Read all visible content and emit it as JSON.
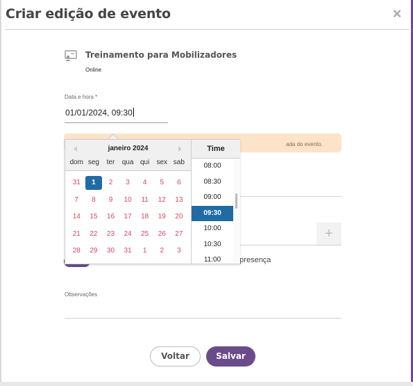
{
  "modal": {
    "title": "Criar edição de evento",
    "close": "×"
  },
  "event": {
    "name": "Treinamento para Mobilizadores",
    "type": "Online",
    "icon": "presentation-icon"
  },
  "datetime": {
    "label": "Data e hora *",
    "value": "01/01/2024, 09:30"
  },
  "warning": {
    "text": "ada do evento."
  },
  "presence": {
    "text": "e presença"
  },
  "plus": "+",
  "observacoes": {
    "label": "Observações"
  },
  "buttons": {
    "back": "Voltar",
    "save": "Salvar"
  },
  "colors": {
    "accent": "#6b4c8a",
    "selected": "#216ba5",
    "day_text": "#d9455f",
    "warning_bg": "#fde3c8"
  },
  "calendar": {
    "month": "janeiro 2024",
    "weekdays": [
      "dom",
      "seg",
      "ter",
      "qua",
      "qui",
      "sex",
      "sab"
    ],
    "weeks": [
      [
        "31",
        "1",
        "2",
        "3",
        "4",
        "5",
        "6"
      ],
      [
        "7",
        "8",
        "9",
        "10",
        "11",
        "12",
        "13"
      ],
      [
        "14",
        "15",
        "16",
        "17",
        "18",
        "19",
        "20"
      ],
      [
        "21",
        "22",
        "23",
        "24",
        "25",
        "26",
        "27"
      ],
      [
        "28",
        "29",
        "30",
        "31",
        "1",
        "2",
        "3"
      ]
    ],
    "selected_day": "1"
  },
  "time": {
    "header": "Time",
    "items": [
      "08:00",
      "08:30",
      "09:00",
      "09:30",
      "10:00",
      "10:30",
      "11:00"
    ],
    "selected": "09:30"
  }
}
